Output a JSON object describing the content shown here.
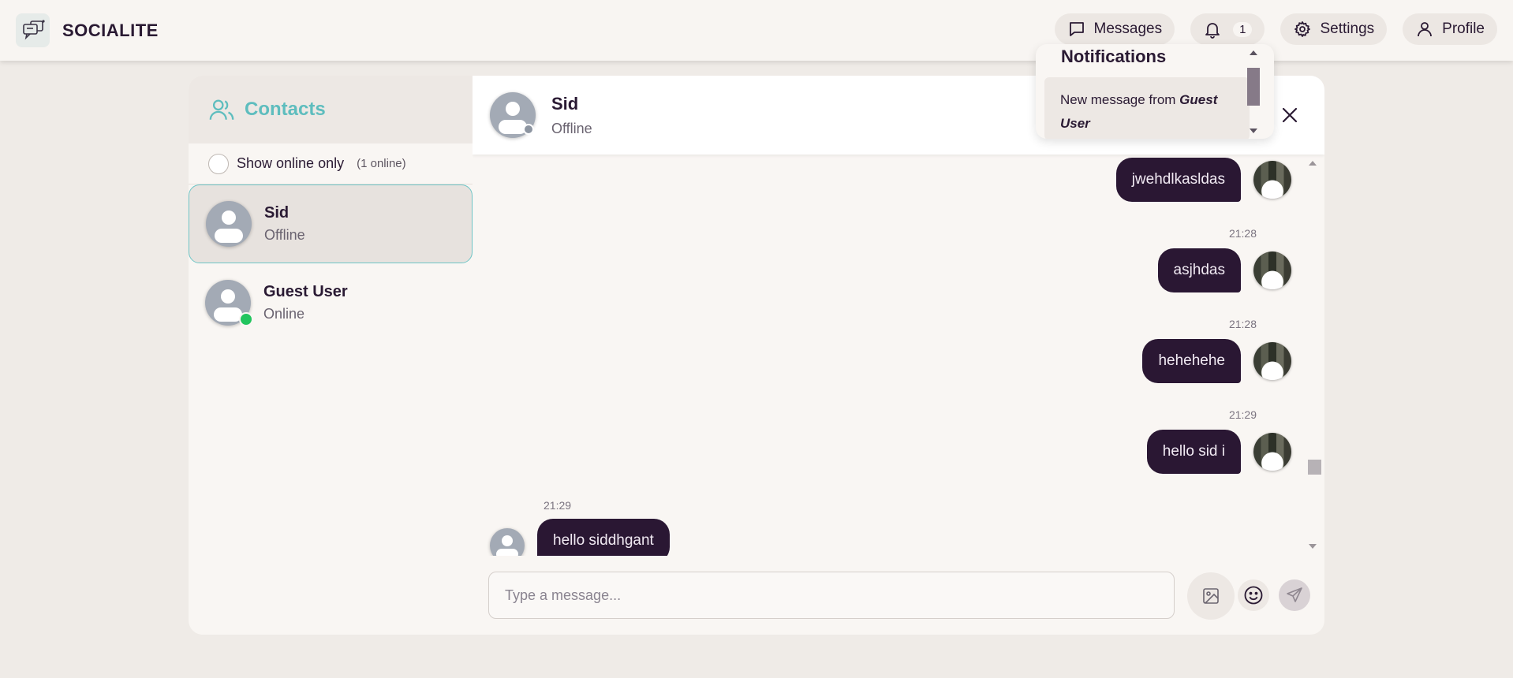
{
  "app": {
    "name": "SOCIALITE"
  },
  "nav": {
    "messages_label": "Messages",
    "notifications_count": "1",
    "settings_label": "Settings",
    "profile_label": "Profile"
  },
  "notifications": {
    "title": "Notifications",
    "items": [
      {
        "prefix": "New message from ",
        "sender": "Guest User"
      }
    ]
  },
  "contacts": {
    "title": "Contacts",
    "online_only_label": "Show online only",
    "online_count": "(1 online)",
    "list": [
      {
        "name": "Sid",
        "status": "Offline",
        "active": true,
        "online": false
      },
      {
        "name": "Guest User",
        "status": "Online",
        "active": false,
        "online": true
      }
    ]
  },
  "chat": {
    "name": "Sid",
    "status": "Offline",
    "messages": [
      {
        "direction": "out",
        "text": "jwehdlkasldas",
        "time": ""
      },
      {
        "direction": "out",
        "text": "asjhdas",
        "time": "21:28"
      },
      {
        "direction": "out",
        "text": "hehehehe",
        "time": "21:28"
      },
      {
        "direction": "out",
        "text": "hello sid i",
        "time": "21:29"
      },
      {
        "direction": "in",
        "text": "hello siddhgant",
        "time": "21:29"
      }
    ],
    "composer_placeholder": "Type a message..."
  },
  "colors": {
    "accent": "#5ebdbe",
    "bubble": "#2a1733",
    "online": "#22c55e",
    "offline": "#8d95a1"
  }
}
